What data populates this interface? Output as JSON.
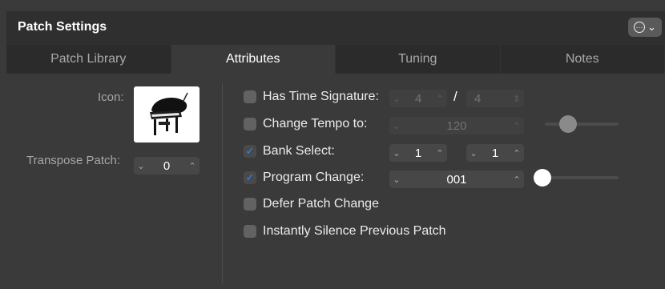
{
  "window": {
    "title": "Patch Settings"
  },
  "tabs": [
    {
      "label": "Patch Library"
    },
    {
      "label": "Attributes"
    },
    {
      "label": "Tuning"
    },
    {
      "label": "Notes"
    }
  ],
  "left": {
    "icon_label": "Icon:",
    "transpose_label": "Transpose Patch:",
    "transpose_value": "0"
  },
  "rows": {
    "time_signature": {
      "label": "Has Time Signature:",
      "checked": false,
      "numerator": "4",
      "denominator": "4",
      "separator": "/"
    },
    "tempo": {
      "label": "Change Tempo to:",
      "checked": false,
      "value": "120"
    },
    "bank_select": {
      "label": "Bank Select:",
      "checked": true,
      "msb": "1",
      "lsb": "1"
    },
    "program_change": {
      "label": "Program Change:",
      "checked": true,
      "value": "001"
    },
    "defer": {
      "label": "Defer Patch Change",
      "checked": false
    },
    "silence": {
      "label": "Instantly Silence Previous Patch",
      "checked": false
    }
  },
  "icons": {
    "chevron_down": "⌄",
    "chevron_up": "⌃",
    "check": "✓"
  },
  "colors": {
    "accent": "#2f85ff"
  }
}
